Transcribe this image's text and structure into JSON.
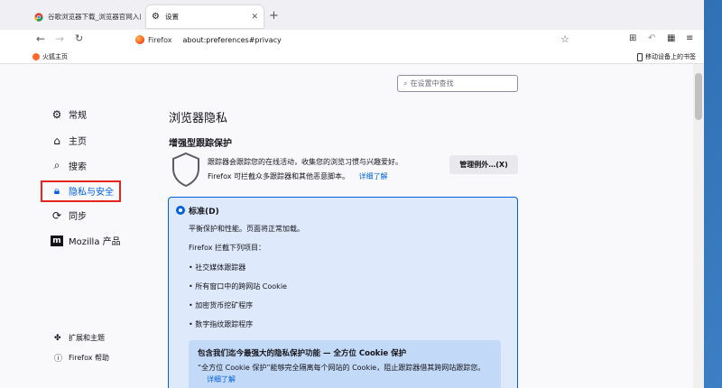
{
  "tabs": [
    {
      "label": "谷歌浏览器下载_浏览器官网入口",
      "close": "✕"
    },
    {
      "label": "设置",
      "close": "✕"
    }
  ],
  "new_tab": "+",
  "nav": {
    "back": "←",
    "forward": "→",
    "reload": "↻"
  },
  "url": {
    "brand": "Firefox",
    "address": "about:preferences#privacy"
  },
  "bookmarks": {
    "left": "火狐主页",
    "right": "移动设备上的书签"
  },
  "search": {
    "placeholder": "在设置中查找"
  },
  "sidebar": {
    "items": [
      {
        "label": "常规"
      },
      {
        "label": "主页"
      },
      {
        "label": "搜索"
      },
      {
        "label": "隐私与安全"
      },
      {
        "label": "同步"
      },
      {
        "label": "Mozilla 产品"
      }
    ],
    "bottom": [
      {
        "label": "扩展和主题"
      },
      {
        "label": "Firefox 帮助"
      }
    ]
  },
  "main": {
    "page_title": "浏览器隐私",
    "section_title": "增强型跟踪保护",
    "desc_line1": "跟踪器会跟踪您的在线活动，收集您的浏览习惯与兴趣爱好。",
    "desc_line2": "Firefox 可拦截众多跟踪器和其他恶意脚本。",
    "learn_more": "详细了解",
    "exceptions_button": "管理例外…(X)",
    "standard": {
      "title": "标准(D)",
      "subtitle": "平衡保护和性能。页面将正常加载。",
      "lead": "Firefox 拦截下列项目：",
      "items": [
        "社交媒体跟踪器",
        "所有窗口中的跨网站 Cookie",
        "加密货币挖矿程序",
        "数字指纹跟踪程序"
      ],
      "promo_title": "包含我们迄今最强大的隐私保护功能 — 全方位 Cookie 保护",
      "promo_body": "“全方位 Cookie 保护”能够完全隔离每个网站的 Cookie，阻止跟踪器借其跨网站跟踪您。",
      "promo_link": "详细了解"
    }
  },
  "colors": {
    "accent": "#0061e0",
    "highlight_box": "#e5251d",
    "standard_bg": "#deeafc"
  }
}
